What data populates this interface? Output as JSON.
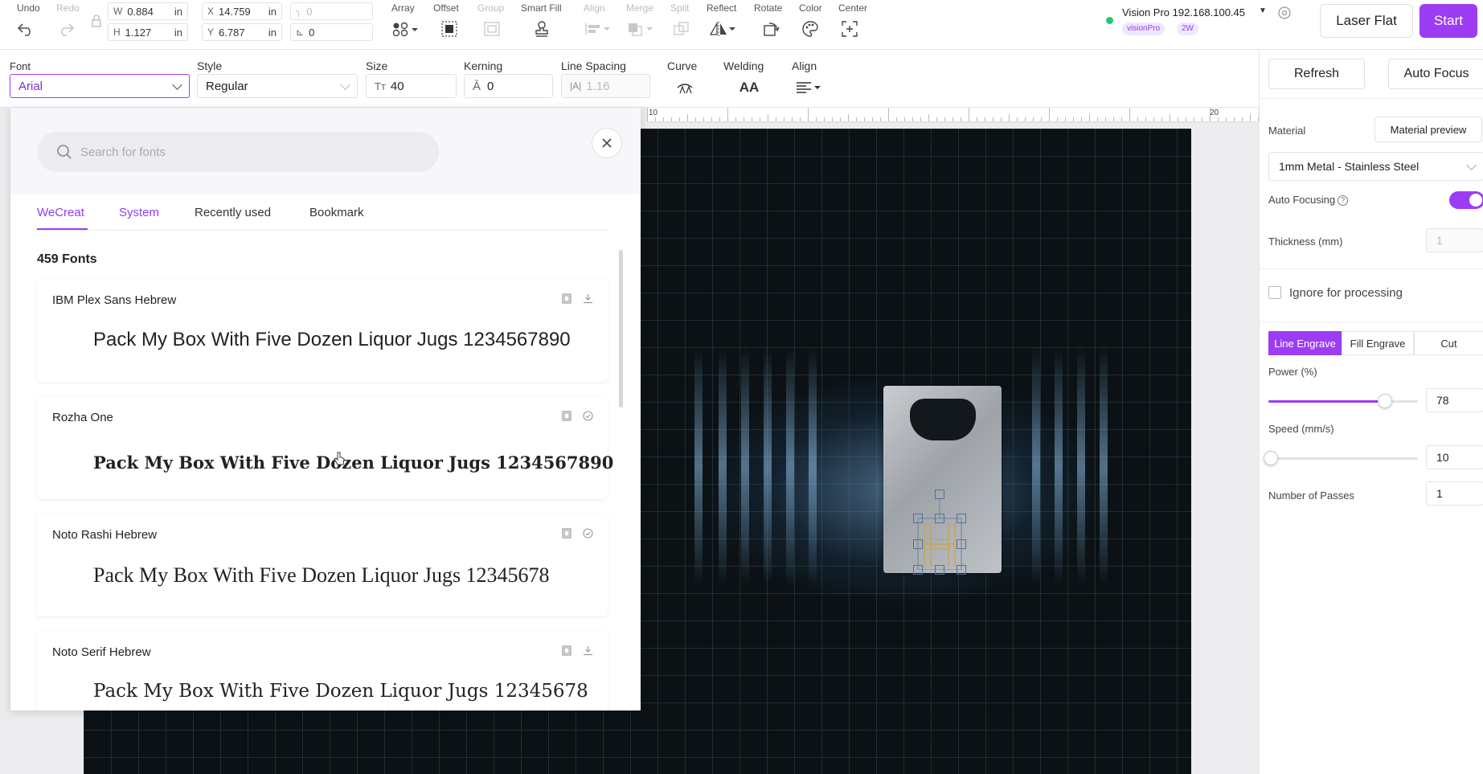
{
  "toolbar": {
    "undo": "Undo",
    "redo": "Redo",
    "width": {
      "prefix": "W",
      "value": "0.884",
      "unit": "in"
    },
    "height": {
      "prefix": "H",
      "value": "1.127",
      "unit": "in"
    },
    "x": {
      "prefix": "X",
      "value": "14.759",
      "unit": "in"
    },
    "y": {
      "prefix": "Y",
      "value": "6.787",
      "unit": "in"
    },
    "corner_radius": "0",
    "skew": "0",
    "array": "Array",
    "offset": "Offset",
    "group": "Group",
    "smart_fill": "Smart Fill",
    "align": "Align",
    "merge": "Merge",
    "split": "Split",
    "reflect": "Reflect",
    "rotate": "Rotate",
    "color": "Color",
    "center": "Center"
  },
  "device": {
    "name": "Vision Pro 192.168.100.45",
    "badge_model": "visionPro",
    "badge_power": "2W",
    "status_color": "#28c76f"
  },
  "actions": {
    "laser_flat": "Laser Flat",
    "start": "Start"
  },
  "text_props": {
    "font_label": "Font",
    "font_value": "Arial",
    "style_label": "Style",
    "style_value": "Regular",
    "size_label": "Size",
    "size_prefix": "Tт",
    "size_value": "40",
    "kerning_label": "Kerning",
    "kerning_value": "0",
    "line_spacing_label": "Line Spacing",
    "line_spacing_prefix": "|A|",
    "line_spacing_value": "1.16",
    "curve_label": "Curve",
    "welding_label": "Welding",
    "welding_icon_text": "AA",
    "align_label": "Align"
  },
  "ruler": {
    "label_a": "10",
    "label_b": "20"
  },
  "font_panel": {
    "search_placeholder": "Search for fonts",
    "tabs": [
      {
        "label": "WeCreat"
      },
      {
        "label": "System"
      },
      {
        "label": "Recently used"
      },
      {
        "label": "Bookmark"
      }
    ],
    "count": "459 Fonts",
    "fonts": [
      {
        "name": "IBM Plex Sans Hebrew",
        "sample": "Pack My Box With Five Dozen Liquor Jugs 1234567890"
      },
      {
        "name": "Rozha One",
        "sample": "Pack My Box With Five Dozen Liquor Jugs 1234567890"
      },
      {
        "name": "Noto Rashi Hebrew",
        "sample": "Pack My Box With Five Dozen Liquor Jugs 12345678"
      },
      {
        "name": "Noto Serif Hebrew",
        "sample": "Pack My Box With Five Dozen Liquor Jugs 12345678"
      }
    ]
  },
  "right_panel": {
    "refresh": "Refresh",
    "auto_focus": "Auto Focus",
    "material_label": "Material",
    "material_preview": "Material preview",
    "material_value": "1mm Metal - Stainless Steel",
    "auto_focusing_label": "Auto Focusing",
    "thickness_label": "Thickness (mm)",
    "thickness_value": "1",
    "ignore_label": "Ignore for processing",
    "modes": [
      "Line Engrave",
      "Fill Engrave",
      "Cut"
    ],
    "power_label": "Power (%)",
    "power_value": "78",
    "speed_label": "Speed (mm/s)",
    "speed_value": "10",
    "passes_label": "Number of Passes",
    "passes_value": "1",
    "accent_color": "#9d3cf5"
  }
}
